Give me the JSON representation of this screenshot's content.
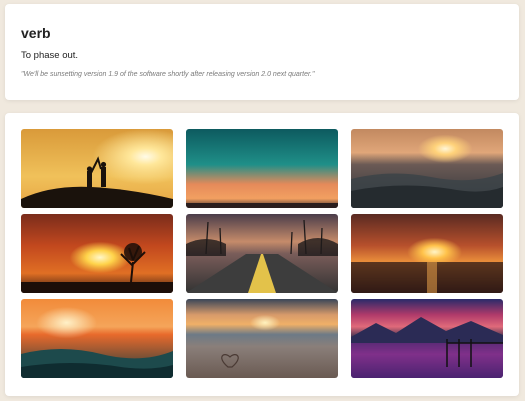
{
  "definition": {
    "word": "verb",
    "meaning": "To phase out.",
    "example": "\"We'll be sunsetting version 1.9 of the software shortly after releasing version 2.0 next quarter.\""
  },
  "gallery": {
    "images": [
      {
        "name": "couple-silhouette-sunset-photo"
      },
      {
        "name": "teal-orange-sky-sunset-photo"
      },
      {
        "name": "ocean-waves-dark-sunset-photo"
      },
      {
        "name": "lone-tree-orange-sunset-photo"
      },
      {
        "name": "palm-tree-road-sunset-photo"
      },
      {
        "name": "sea-horizon-red-sunset-photo"
      },
      {
        "name": "orange-sea-waves-sunset-photo"
      },
      {
        "name": "beach-heart-sand-sunset-photo"
      },
      {
        "name": "mountain-lake-purple-sunset-photo"
      }
    ]
  }
}
